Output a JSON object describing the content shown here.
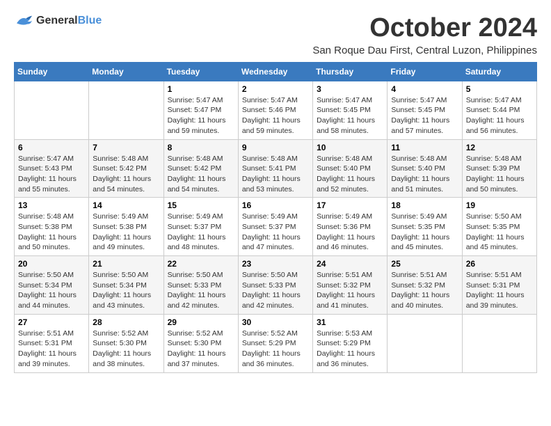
{
  "header": {
    "logo": {
      "general": "General",
      "blue": "Blue"
    },
    "title": "October 2024",
    "subtitle": "San Roque Dau First, Central Luzon, Philippines"
  },
  "weekdays": [
    "Sunday",
    "Monday",
    "Tuesday",
    "Wednesday",
    "Thursday",
    "Friday",
    "Saturday"
  ],
  "weeks": [
    [
      {
        "day": "",
        "content": ""
      },
      {
        "day": "",
        "content": ""
      },
      {
        "day": "1",
        "content": "Sunrise: 5:47 AM\nSunset: 5:47 PM\nDaylight: 11 hours and 59 minutes."
      },
      {
        "day": "2",
        "content": "Sunrise: 5:47 AM\nSunset: 5:46 PM\nDaylight: 11 hours and 59 minutes."
      },
      {
        "day": "3",
        "content": "Sunrise: 5:47 AM\nSunset: 5:45 PM\nDaylight: 11 hours and 58 minutes."
      },
      {
        "day": "4",
        "content": "Sunrise: 5:47 AM\nSunset: 5:45 PM\nDaylight: 11 hours and 57 minutes."
      },
      {
        "day": "5",
        "content": "Sunrise: 5:47 AM\nSunset: 5:44 PM\nDaylight: 11 hours and 56 minutes."
      }
    ],
    [
      {
        "day": "6",
        "content": "Sunrise: 5:47 AM\nSunset: 5:43 PM\nDaylight: 11 hours and 55 minutes."
      },
      {
        "day": "7",
        "content": "Sunrise: 5:48 AM\nSunset: 5:42 PM\nDaylight: 11 hours and 54 minutes."
      },
      {
        "day": "8",
        "content": "Sunrise: 5:48 AM\nSunset: 5:42 PM\nDaylight: 11 hours and 54 minutes."
      },
      {
        "day": "9",
        "content": "Sunrise: 5:48 AM\nSunset: 5:41 PM\nDaylight: 11 hours and 53 minutes."
      },
      {
        "day": "10",
        "content": "Sunrise: 5:48 AM\nSunset: 5:40 PM\nDaylight: 11 hours and 52 minutes."
      },
      {
        "day": "11",
        "content": "Sunrise: 5:48 AM\nSunset: 5:40 PM\nDaylight: 11 hours and 51 minutes."
      },
      {
        "day": "12",
        "content": "Sunrise: 5:48 AM\nSunset: 5:39 PM\nDaylight: 11 hours and 50 minutes."
      }
    ],
    [
      {
        "day": "13",
        "content": "Sunrise: 5:48 AM\nSunset: 5:38 PM\nDaylight: 11 hours and 50 minutes."
      },
      {
        "day": "14",
        "content": "Sunrise: 5:49 AM\nSunset: 5:38 PM\nDaylight: 11 hours and 49 minutes."
      },
      {
        "day": "15",
        "content": "Sunrise: 5:49 AM\nSunset: 5:37 PM\nDaylight: 11 hours and 48 minutes."
      },
      {
        "day": "16",
        "content": "Sunrise: 5:49 AM\nSunset: 5:37 PM\nDaylight: 11 hours and 47 minutes."
      },
      {
        "day": "17",
        "content": "Sunrise: 5:49 AM\nSunset: 5:36 PM\nDaylight: 11 hours and 46 minutes."
      },
      {
        "day": "18",
        "content": "Sunrise: 5:49 AM\nSunset: 5:35 PM\nDaylight: 11 hours and 45 minutes."
      },
      {
        "day": "19",
        "content": "Sunrise: 5:50 AM\nSunset: 5:35 PM\nDaylight: 11 hours and 45 minutes."
      }
    ],
    [
      {
        "day": "20",
        "content": "Sunrise: 5:50 AM\nSunset: 5:34 PM\nDaylight: 11 hours and 44 minutes."
      },
      {
        "day": "21",
        "content": "Sunrise: 5:50 AM\nSunset: 5:34 PM\nDaylight: 11 hours and 43 minutes."
      },
      {
        "day": "22",
        "content": "Sunrise: 5:50 AM\nSunset: 5:33 PM\nDaylight: 11 hours and 42 minutes."
      },
      {
        "day": "23",
        "content": "Sunrise: 5:50 AM\nSunset: 5:33 PM\nDaylight: 11 hours and 42 minutes."
      },
      {
        "day": "24",
        "content": "Sunrise: 5:51 AM\nSunset: 5:32 PM\nDaylight: 11 hours and 41 minutes."
      },
      {
        "day": "25",
        "content": "Sunrise: 5:51 AM\nSunset: 5:32 PM\nDaylight: 11 hours and 40 minutes."
      },
      {
        "day": "26",
        "content": "Sunrise: 5:51 AM\nSunset: 5:31 PM\nDaylight: 11 hours and 39 minutes."
      }
    ],
    [
      {
        "day": "27",
        "content": "Sunrise: 5:51 AM\nSunset: 5:31 PM\nDaylight: 11 hours and 39 minutes."
      },
      {
        "day": "28",
        "content": "Sunrise: 5:52 AM\nSunset: 5:30 PM\nDaylight: 11 hours and 38 minutes."
      },
      {
        "day": "29",
        "content": "Sunrise: 5:52 AM\nSunset: 5:30 PM\nDaylight: 11 hours and 37 minutes."
      },
      {
        "day": "30",
        "content": "Sunrise: 5:52 AM\nSunset: 5:29 PM\nDaylight: 11 hours and 36 minutes."
      },
      {
        "day": "31",
        "content": "Sunrise: 5:53 AM\nSunset: 5:29 PM\nDaylight: 11 hours and 36 minutes."
      },
      {
        "day": "",
        "content": ""
      },
      {
        "day": "",
        "content": ""
      }
    ]
  ]
}
